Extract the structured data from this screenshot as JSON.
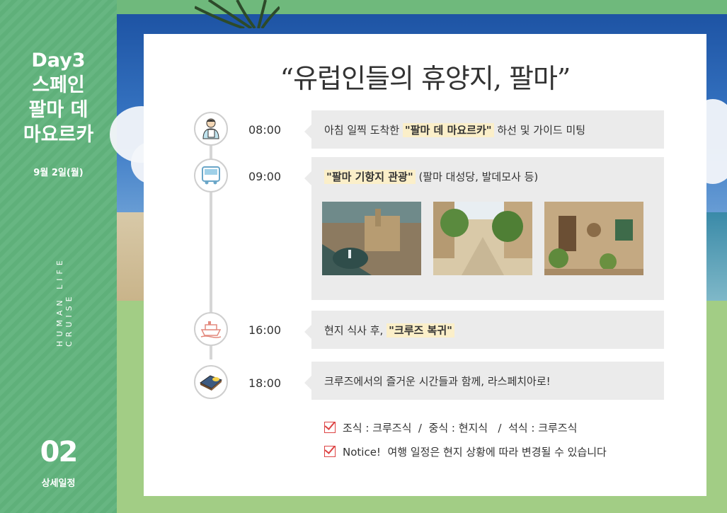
{
  "sidebar": {
    "title_lines": [
      "Day3",
      "스페인",
      "팔마 데",
      "마요르카"
    ],
    "date": "9월 2일(월)",
    "vertical_text": "HUMAN LIFE CRUISE",
    "page_number": "02",
    "page_label": "상세일정"
  },
  "heading": "“유럽인들의 휴양지, 팔마”",
  "schedule": [
    {
      "time": "08:00",
      "icon": "guide-person-icon",
      "pre": "아침 일찍 도착한 ",
      "highlight": "\"팔마 데 마요르카\"",
      "post": " 하선 및 가이드 미팅"
    },
    {
      "time": "09:00",
      "icon": "bus-icon",
      "pre": "",
      "highlight": "\"팔마 기항지 관광\"",
      "post": " (팔마 대성당, 발데모사 등)"
    },
    {
      "time": "16:00",
      "icon": "cruise-ship-icon",
      "pre": "현지 식사 후, ",
      "highlight": "\"크루즈 복귀\"",
      "post": ""
    },
    {
      "time": "18:00",
      "icon": "bed-icon",
      "pre": "크루즈에서의 즐거운 시간들과 함께, 라스페치아로!",
      "highlight": "",
      "post": ""
    }
  ],
  "notes": {
    "meals": "조식 : 크루즈식  /  중식 : 현지식   /  석식 : 크루즈식",
    "notice": "Notice!  여행 일정은 현지 상황에 따라 변경될 수 있습니다"
  },
  "colors": {
    "sidebar_green": "#5fb07a",
    "highlight": "#fbefc9",
    "bubble": "#ebebeb"
  }
}
